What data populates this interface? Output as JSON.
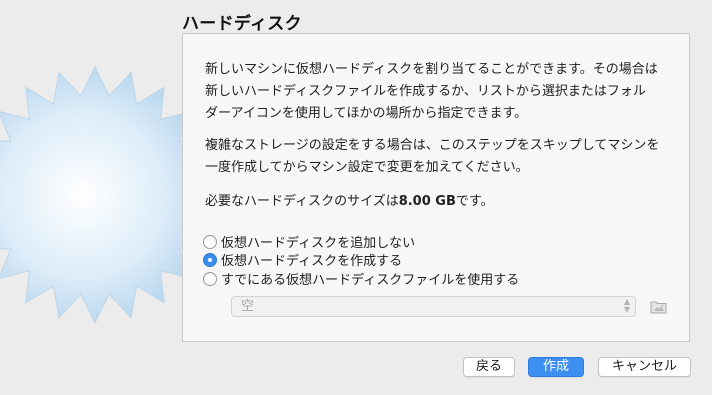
{
  "title": "ハードディスク",
  "paragraphs": {
    "intro": "新しいマシンに仮想ハードディスクを割り当てることができます。その場合は\n新しいハードディスクファイルを作成するか、リストから選択またはフォル\nダーアイコンを使用してほかの場所から指定できます。",
    "skip": "複雑なストレージの設定をする場合は、このステップをスキップしてマシンを\n一度作成してからマシン設定で変更を加えてください。",
    "size_prefix": "必要なハードディスクのサイズは",
    "size_value": "8.00 GB",
    "size_suffix": "です。"
  },
  "options": [
    {
      "label": "仮想ハードディスクを追加しない",
      "selected": false
    },
    {
      "label": "仮想ハードディスクを作成する",
      "selected": true
    },
    {
      "label": "すでにある仮想ハードディスクファイルを使用する",
      "selected": false
    }
  ],
  "disk_select": {
    "value": "空",
    "disabled": true
  },
  "buttons": {
    "back": "戻る",
    "create": "作成",
    "cancel": "キャンセル"
  },
  "icons": {
    "decor": "starburst-image",
    "folder": "folder-icon"
  },
  "colors": {
    "accent": "#3d8ff2"
  }
}
